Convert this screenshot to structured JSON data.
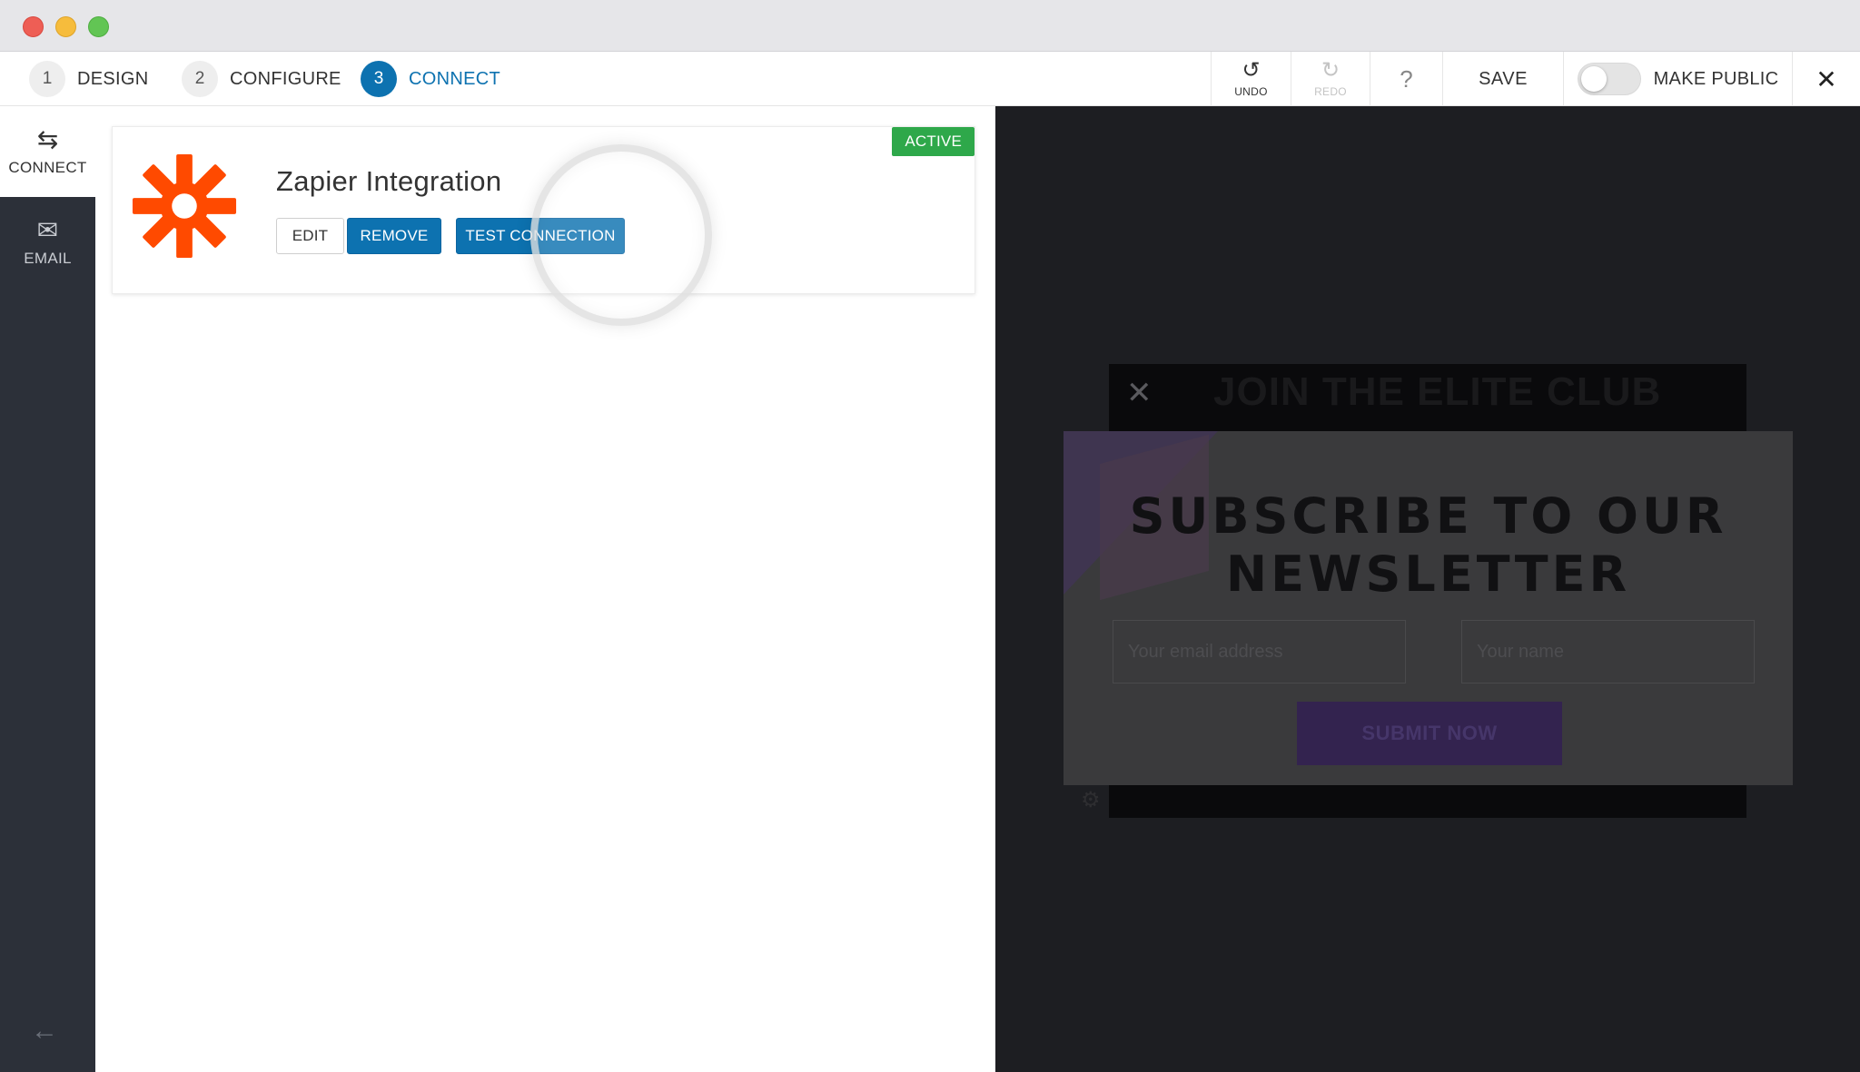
{
  "steps": [
    {
      "num": "1",
      "label": "DESIGN"
    },
    {
      "num": "2",
      "label": "CONFIGURE"
    },
    {
      "num": "3",
      "label": "CONNECT"
    }
  ],
  "toolbar": {
    "undo": "UNDO",
    "redo": "REDO",
    "help": "?",
    "save": "SAVE",
    "make_public": "MAKE PUBLIC",
    "close": "✕"
  },
  "sidebar": {
    "connect": "CONNECT",
    "email": "EMAIL"
  },
  "integration": {
    "status": "ACTIVE",
    "title": "Zapier Integration",
    "edit": "EDIT",
    "remove": "REMOVE",
    "test": "TEST CONNECTION"
  },
  "preview": {
    "back_close": "✕",
    "back_title": "JOIN THE ELITE CLUB",
    "title": "SUBSCRIBE TO OUR NEWSLETTER",
    "email_placeholder": "Your email address",
    "name_placeholder": "Your name",
    "submit": "SUBMIT NOW"
  },
  "colors": {
    "accent": "#0d72b0",
    "active_badge": "#2ea84a",
    "zapier": "#ff4a00",
    "sidebar_bg": "#2c3039"
  }
}
